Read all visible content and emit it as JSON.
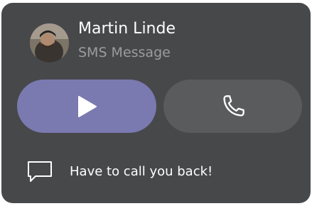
{
  "contact": {
    "name": "Martin Linde",
    "subtitle": "SMS Message",
    "avatar_icon": "person-photo"
  },
  "actions": {
    "play_icon": "play-icon",
    "call_icon": "phone-icon"
  },
  "quick_reply": {
    "icon": "chat-bubble-icon",
    "text": "Have to call you back!"
  },
  "colors": {
    "card_bg": "#47484a",
    "play_button": "#7a79b0",
    "call_button": "#5a5b5d",
    "subtitle": "#9b9c9e"
  }
}
